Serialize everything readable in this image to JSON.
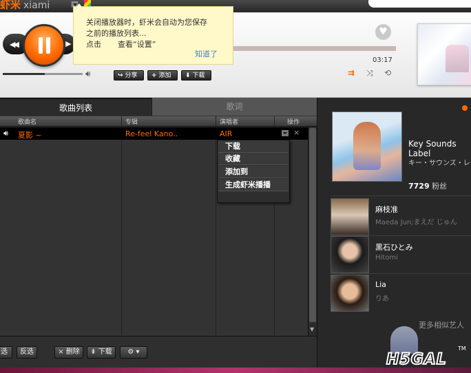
{
  "app": {
    "logo_cn": "虾米",
    "logo_en": "xiami"
  },
  "tooltip": {
    "line1": "关闭播放器时，虾米会自动为您保存",
    "line2": "之前的播放列表...",
    "line3_prefix": "点击",
    "line3_view": "查看“设置”",
    "ok": "知道了"
  },
  "player": {
    "prev_icon": "◀◀",
    "next_icon": "▶",
    "play_state": "pause",
    "volume_level": 0.53,
    "time": "03:17",
    "actions": {
      "share": "分享",
      "add": "添加",
      "download": "下载"
    },
    "icons": {
      "share": "share-icon",
      "add": "plus-icon",
      "download": "download-icon",
      "volume": "speaker-icon",
      "heart": "heart-icon"
    },
    "modes": [
      "list-loop-icon",
      "shuffle-icon",
      "repeat-icon"
    ]
  },
  "playlist": {
    "tabs": {
      "list": "歌曲列表",
      "lyrics": "歌词"
    },
    "columns": {
      "song": "歌曲名",
      "album": "专辑",
      "artist": "演唱者",
      "ops": "操作"
    },
    "rows": [
      {
        "song": "夏影 ~",
        "album": "Re-feel Kano..",
        "artist": "AIR"
      }
    ],
    "context_menu": [
      "下载",
      "收藏",
      "添加到",
      "生成虾米播播"
    ],
    "footer": {
      "select": "选",
      "invert": "反选",
      "delete": "删除",
      "download": "下载"
    }
  },
  "artist_panel": {
    "main": {
      "name": "Key Sounds Label",
      "sub": "キー・サウンズ・レーベル",
      "fans_count": "7729",
      "fans_label": "粉丝"
    },
    "similar": [
      {
        "name": "麻枝准",
        "sub": "Maeda Jun;まえだ じゅん"
      },
      {
        "name": "黒石ひとみ",
        "sub": "Hitomi"
      },
      {
        "name": "Lia",
        "sub": "りあ"
      }
    ],
    "more": "更多相似艺人",
    "badge": "H5GAL",
    "badge_tm": "TM"
  },
  "colors": {
    "accent": "#ff6a00",
    "tooltip_bg": "#fff8c8",
    "link": "#4a7fc4"
  }
}
